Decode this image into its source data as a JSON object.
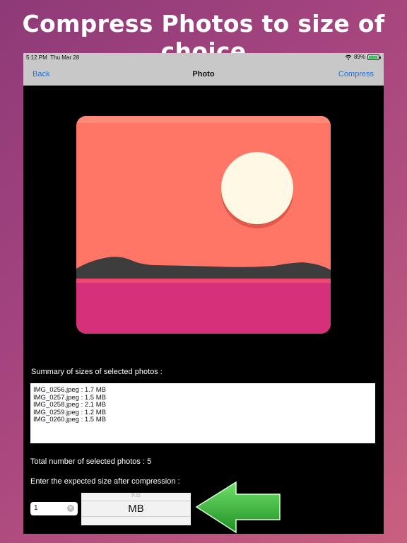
{
  "headline": "Compress Photos to size of choice",
  "status_bar": {
    "time": "5:12 PM",
    "date": "Thu Mar 28",
    "battery": "89%",
    "wifi_icon": "wifi-icon",
    "battery_icon": "battery-charging-icon"
  },
  "navbar": {
    "back_label": "Back",
    "title": "Photo",
    "compress_label": "Compress"
  },
  "photo": {
    "icon": "landscape-sunset-image",
    "colors": {
      "sky": "#ff7666",
      "sun": "#fff8e5",
      "hills": "#3d3d3d",
      "ground": "#d6307a"
    }
  },
  "summary": {
    "label": "Summary of sizes of selected photos :",
    "items": [
      "IMG_0256.jpeg : 1.7 MB",
      "IMG_0257.jpeg : 1.5 MB",
      "IMG_0258.jpeg : 2.1 MB",
      "IMG_0259.jpeg : 1.2 MB",
      "IMG_0260.jpeg : 1.5 MB"
    ]
  },
  "total_label": "Total number of selected photos : 5",
  "enter_label": "Enter the expected size after compression :",
  "size_input": {
    "value": "1"
  },
  "unit_picker": {
    "options": [
      "KB",
      "MB"
    ],
    "selected": "MB"
  },
  "accent_colors": {
    "link": "#1a73e8",
    "arrow": "#2fb52f"
  }
}
